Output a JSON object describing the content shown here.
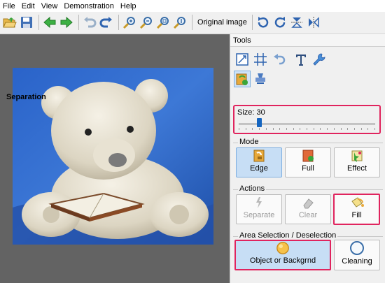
{
  "menu": [
    "File",
    "Edit",
    "View",
    "Demonstration",
    "Help"
  ],
  "toolbar": {
    "original_image_label": "Original image"
  },
  "tools_panel": {
    "title": "Tools",
    "section_title": "Separation",
    "size": {
      "label": "Size: 30",
      "value": 30,
      "min": 0,
      "max": 200
    },
    "mode": {
      "title": "Mode",
      "buttons": [
        "Edge",
        "Full",
        "Effect"
      ],
      "selected": "Edge"
    },
    "actions": {
      "title": "Actions",
      "buttons": [
        "Separate",
        "Clear",
        "Fill"
      ],
      "disabled": [
        "Separate",
        "Clear"
      ],
      "highlighted": "Fill"
    },
    "area_selection": {
      "title": "Area Selection / Deselection",
      "buttons": [
        "Object or Backgrnd",
        "Cleaning"
      ],
      "selected": "Object or Backgrnd"
    }
  },
  "colors": {
    "highlight": "#e0245e",
    "selected": "#c7def5",
    "canvas_bg": "#636363"
  }
}
